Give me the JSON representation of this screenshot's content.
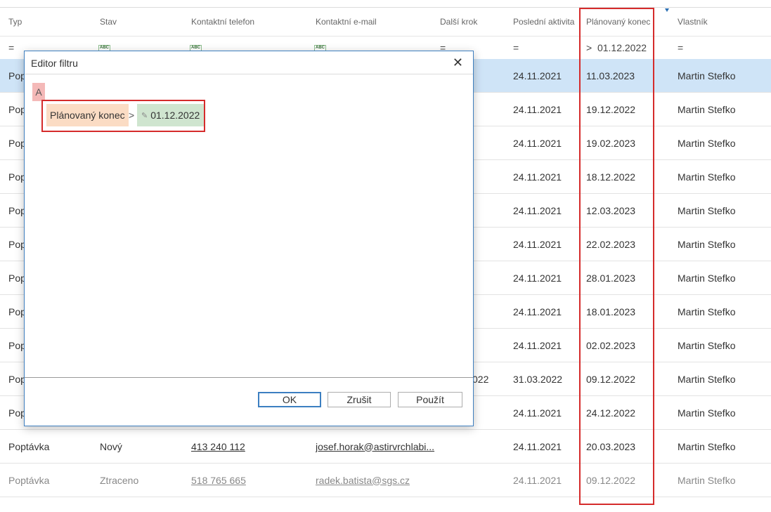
{
  "columns": {
    "typ": "Typ",
    "stav": "Stav",
    "telefon": "Kontaktní telefon",
    "email": "Kontaktní e-mail",
    "dalsi_krok": "Další krok",
    "posledni_aktivita": "Poslední aktivita",
    "planovany_konec": "Plánovaný konec",
    "vlastnik": "Vlastník"
  },
  "filters": {
    "typ": "=",
    "stav": "ABC",
    "telefon": "ABC",
    "email": "ABC",
    "dalsi_krok": "=",
    "posledni_aktivita": "=",
    "planovany_konec": ">  01.12.2022",
    "vlastnik": "="
  },
  "rows": [
    {
      "typ": "Pop",
      "stav": "",
      "telefon": "",
      "email": "",
      "dalsi_krok": "",
      "posledni_aktivita": "24.11.2021",
      "planovany_konec": "11.03.2023",
      "vlastnik": "Martin Stefko"
    },
    {
      "typ": "Pop",
      "stav": "",
      "telefon": "",
      "email": "",
      "dalsi_krok": "",
      "posledni_aktivita": "24.11.2021",
      "planovany_konec": "19.12.2022",
      "vlastnik": "Martin Stefko"
    },
    {
      "typ": "Pop",
      "stav": "",
      "telefon": "",
      "email": "",
      "dalsi_krok": "",
      "posledni_aktivita": "24.11.2021",
      "planovany_konec": "19.02.2023",
      "vlastnik": "Martin Stefko"
    },
    {
      "typ": "Pop",
      "stav": "",
      "telefon": "",
      "email": "",
      "dalsi_krok": "",
      "posledni_aktivita": "24.11.2021",
      "planovany_konec": "18.12.2022",
      "vlastnik": "Martin Stefko"
    },
    {
      "typ": "Pop",
      "stav": "",
      "telefon": "",
      "email": "",
      "dalsi_krok": "",
      "posledni_aktivita": "24.11.2021",
      "planovany_konec": "12.03.2023",
      "vlastnik": "Martin Stefko"
    },
    {
      "typ": "Pop",
      "stav": "",
      "telefon": "",
      "email": "",
      "dalsi_krok": "",
      "posledni_aktivita": "24.11.2021",
      "planovany_konec": "22.02.2023",
      "vlastnik": "Martin Stefko"
    },
    {
      "typ": "Pop",
      "stav": "",
      "telefon": "",
      "email": "",
      "dalsi_krok": "",
      "posledni_aktivita": "24.11.2021",
      "planovany_konec": "28.01.2023",
      "vlastnik": "Martin Stefko"
    },
    {
      "typ": "Pop",
      "stav": "",
      "telefon": "",
      "email": "",
      "dalsi_krok": "",
      "posledni_aktivita": "24.11.2021",
      "planovany_konec": "18.01.2023",
      "vlastnik": "Martin Stefko"
    },
    {
      "typ": "Pop",
      "stav": "",
      "telefon": "",
      "email": "",
      "dalsi_krok": "",
      "posledni_aktivita": "24.11.2021",
      "planovany_konec": "02.02.2023",
      "vlastnik": "Martin Stefko"
    },
    {
      "typ": "Pop",
      "stav": "",
      "telefon": "",
      "email": "",
      "dalsi_krok": "022",
      "posledni_aktivita": "31.03.2022",
      "planovany_konec": "09.12.2022",
      "vlastnik": "Martin Stefko"
    },
    {
      "typ": "Pop",
      "stav": "",
      "telefon": "",
      "email": "",
      "dalsi_krok": "",
      "posledni_aktivita": "24.11.2021",
      "planovany_konec": "24.12.2022",
      "vlastnik": "Martin Stefko"
    },
    {
      "typ": "Poptávka",
      "stav": "Nový",
      "telefon": "413 240 112",
      "email": "josef.horak@astirvrchlabi...",
      "dalsi_krok": "",
      "posledni_aktivita": "24.11.2021",
      "planovany_konec": "20.03.2023",
      "vlastnik": "Martin Stefko"
    },
    {
      "typ": "Poptávka",
      "stav": "Ztraceno",
      "telefon": "518 765 665",
      "email": "radek.batista@sgs.cz",
      "dalsi_krok": "",
      "posledni_aktivita": "24.11.2021",
      "planovany_konec": "09.12.2022",
      "vlastnik": "Martin Stefko"
    }
  ],
  "dialog": {
    "title": "Editor filtru",
    "close_glyph": "✕",
    "group_label": "A",
    "condition": {
      "field": "Plánovaný konec",
      "operator": ">",
      "value": "01.12.2022"
    },
    "ok_label": "OK",
    "cancel_label": "Zrušit",
    "apply_label": "Použít"
  },
  "icons": {
    "column_filter": "filter-active-icon",
    "value_edit": "pencil-icon"
  },
  "colors": {
    "selected_row": "#cfe4f7",
    "highlight": "#d52b2b",
    "field_chip": "#fbdcc4",
    "value_chip": "#cfe5cf",
    "group_chip": "#f4b9b8"
  }
}
